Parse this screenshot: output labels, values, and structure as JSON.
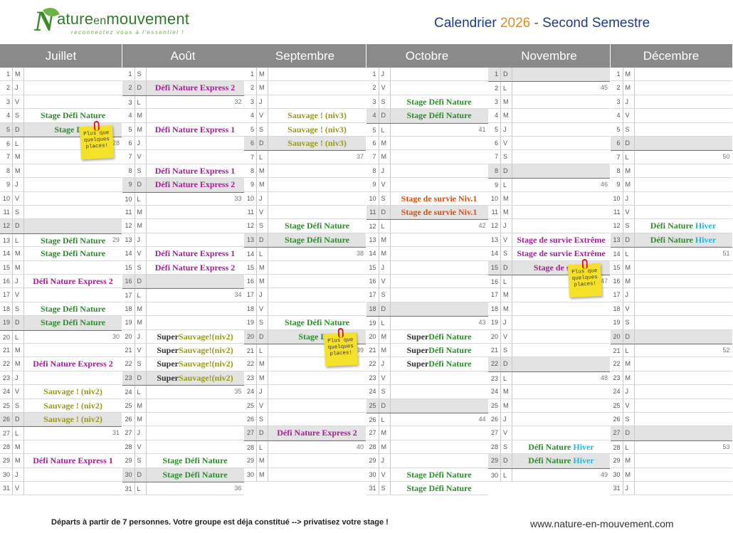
{
  "brand": {
    "logo_main": "ature",
    "logo_em": "en",
    "logo_end": "mouvement",
    "logo_initial": "N",
    "tagline": "reconnectez vous à l'essentiel !"
  },
  "title": {
    "prefix": "Calendrier ",
    "year": "2026",
    "sep": " - ",
    "suffix": "Second Semestre"
  },
  "sticky_text": "Plus que quelques places!",
  "footer": {
    "note": "Départs à partir de 7 personnes. Votre groupe est déja constitué --> privatisez votre stage !",
    "website": "www.nature-en-mouvement.com"
  },
  "months": [
    {
      "name": "Juillet",
      "wd": [
        "M",
        "J",
        "V",
        "S",
        "D",
        "L",
        "M",
        "M",
        "J",
        "V",
        "S",
        "D",
        "L",
        "M",
        "M",
        "J",
        "V",
        "S",
        "D",
        "L",
        "M",
        "M",
        "J",
        "V",
        "S",
        "D",
        "L",
        "M",
        "M",
        "J",
        "V"
      ],
      "weeks": {
        "6": "28",
        "13": "29",
        "20": "30",
        "27": "31"
      },
      "events": {
        "4": [
          "Stage Défi Nature",
          "green"
        ],
        "5": [
          "Stage Défi",
          "green"
        ],
        "13": [
          "Stage Défi Nature",
          "green"
        ],
        "14": [
          "Stage Défi Nature",
          "green"
        ],
        "16": [
          "Défi Nature Express 2",
          "purple"
        ],
        "18": [
          "Stage Défi Nature",
          "green"
        ],
        "19": [
          "Stage Défi Nature",
          "green"
        ],
        "22": [
          "Défi Nature Express 2",
          "purple"
        ],
        "24": [
          "Sauvage ! (niv2)",
          "olive"
        ],
        "25": [
          "Sauvage ! (niv2)",
          "olive"
        ],
        "26": [
          "Sauvage ! (niv2)",
          "olive"
        ],
        "29": [
          "Défi Nature Express 1",
          "purple"
        ]
      }
    },
    {
      "name": "Août",
      "wd": [
        "S",
        "D",
        "L",
        "M",
        "M",
        "J",
        "V",
        "S",
        "D",
        "L",
        "M",
        "M",
        "J",
        "V",
        "S",
        "D",
        "L",
        "M",
        "M",
        "J",
        "V",
        "S",
        "D",
        "L",
        "M",
        "M",
        "J",
        "V",
        "S",
        "D",
        "L"
      ],
      "weeks": {
        "3": "32",
        "10": "33",
        "17": "34",
        "24": "35",
        "31": "36"
      },
      "events": {
        "2": [
          "Défi Nature Express 2",
          "purple"
        ],
        "5": [
          "Défi Nature Express 1",
          "purple"
        ],
        "8": [
          "Défi Nature Express 1",
          "purple"
        ],
        "9": [
          "Défi Nature Express 2",
          "purple"
        ],
        "14": [
          "Défi Nature Express 1",
          "purple"
        ],
        "15": [
          "Défi Nature Express 2",
          "purple"
        ],
        "20": [
          "SuperSauvage!(niv2)",
          "olive"
        ],
        "21": [
          "SuperSauvage!(niv2)",
          "olive"
        ],
        "22": [
          "SuperSauvage!(niv2)",
          "olive"
        ],
        "23": [
          "SuperSauvage!(niv2)",
          "olive"
        ],
        "29": [
          "Stage Défi Nature",
          "green"
        ],
        "30": [
          "Stage Défi Nature",
          "green"
        ]
      }
    },
    {
      "name": "Septembre",
      "wd": [
        "M",
        "M",
        "J",
        "V",
        "S",
        "D",
        "L",
        "M",
        "M",
        "J",
        "V",
        "S",
        "D",
        "L",
        "M",
        "M",
        "J",
        "V",
        "S",
        "D",
        "L",
        "M",
        "M",
        "J",
        "V",
        "S",
        "D",
        "L",
        "M",
        "M"
      ],
      "weeks": {
        "7": "37",
        "14": "38",
        "21": "39",
        "28": "40"
      },
      "events": {
        "4": [
          "Sauvage ! (niv3)",
          "olive"
        ],
        "5": [
          "Sauvage ! (niv3)",
          "olive"
        ],
        "6": [
          "Sauvage ! (niv3)",
          "olive"
        ],
        "12": [
          "Stage Défi Nature",
          "green"
        ],
        "13": [
          "Stage Défi Nature",
          "green"
        ],
        "19": [
          "Stage Défi Nature",
          "green"
        ],
        "20": [
          "Stage Défi",
          "green"
        ],
        "27": [
          "Défi Nature Express 2",
          "purple"
        ]
      }
    },
    {
      "name": "Octobre",
      "wd": [
        "J",
        "V",
        "S",
        "D",
        "L",
        "M",
        "M",
        "J",
        "V",
        "S",
        "D",
        "L",
        "M",
        "M",
        "J",
        "V",
        "S",
        "D",
        "L",
        "M",
        "M",
        "J",
        "V",
        "S",
        "D",
        "L",
        "M",
        "M",
        "J",
        "V",
        "S"
      ],
      "weeks": {
        "5": "41",
        "12": "42",
        "19": "43",
        "26": "44"
      },
      "events": {
        "3": [
          "Stage Défi Nature",
          "green"
        ],
        "4": [
          "Stage Défi Nature",
          "green"
        ],
        "10": [
          "Stage de survie Niv.1",
          "orange"
        ],
        "11": [
          "Stage de survie Niv.1",
          "orange"
        ],
        "20": [
          "SuperDéfi Nature",
          "green"
        ],
        "21": [
          "SuperDéfi Nature",
          "green"
        ],
        "22": [
          "SuperDéfi Nature",
          "green"
        ],
        "30": [
          "Stage Défi Nature",
          "green"
        ],
        "31": [
          "Stage Défi Nature",
          "green"
        ]
      }
    },
    {
      "name": "Novembre",
      "wd": [
        "D",
        "L",
        "M",
        "M",
        "J",
        "V",
        "S",
        "D",
        "L",
        "M",
        "M",
        "J",
        "V",
        "S",
        "D",
        "L",
        "M",
        "M",
        "J",
        "V",
        "S",
        "D",
        "L",
        "M",
        "M",
        "J",
        "V",
        "S",
        "D",
        "L"
      ],
      "weeks": {
        "2": "45",
        "9": "46",
        "16": "47",
        "23": "48",
        "30": "49"
      },
      "events": {
        "13": [
          "Stage de survie Extrême",
          "purple"
        ],
        "14": [
          "Stage de survie Extrême",
          "purple"
        ],
        "15": [
          "Stage de survie",
          "purple"
        ],
        "28": [
          "Défi Nature Hiver",
          "green"
        ],
        "29": [
          "Défi Nature Hiver",
          "green"
        ]
      }
    },
    {
      "name": "Décembre",
      "wd": [
        "M",
        "M",
        "J",
        "V",
        "S",
        "D",
        "L",
        "M",
        "M",
        "J",
        "V",
        "S",
        "D",
        "L",
        "M",
        "M",
        "J",
        "V",
        "S",
        "D",
        "L",
        "M",
        "M",
        "J",
        "V",
        "S",
        "D",
        "L",
        "M",
        "M",
        "J"
      ],
      "weeks": {
        "7": "50",
        "14": "51",
        "21": "52",
        "28": "53"
      },
      "events": {
        "12": [
          "Défi Nature Hiver",
          "green"
        ],
        "13": [
          "Défi Nature Hiver",
          "green"
        ]
      }
    }
  ]
}
